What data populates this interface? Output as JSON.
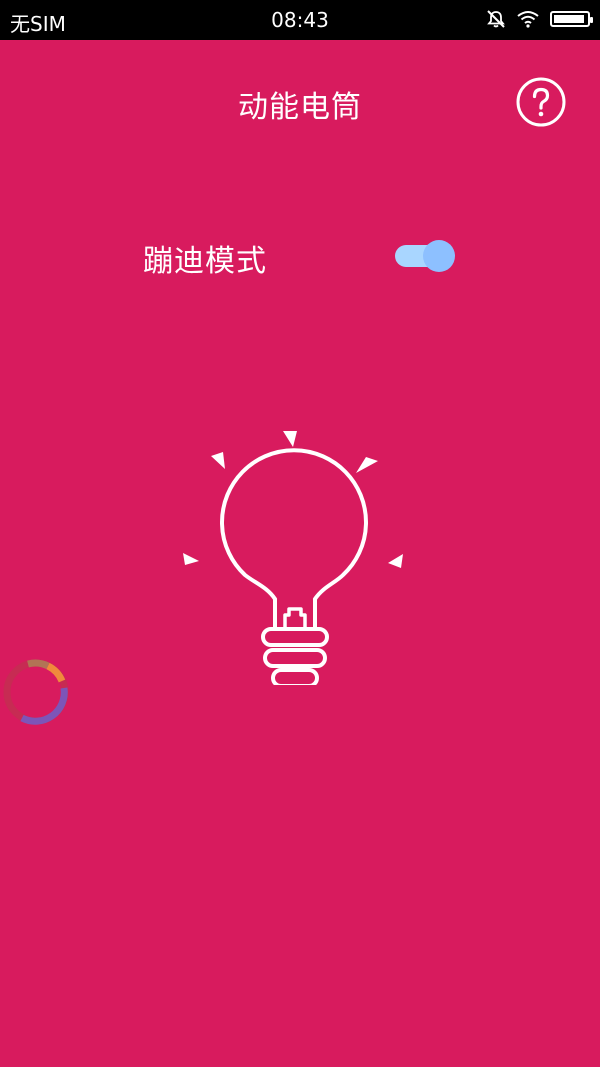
{
  "status_bar": {
    "carrier": "无SIM",
    "time": "08:43",
    "battery_level": 0.95,
    "icons": [
      "mute-icon",
      "wifi-icon",
      "battery-icon"
    ]
  },
  "header": {
    "title": "动能电筒",
    "help_icon": "question-circle-icon"
  },
  "mode": {
    "label": "蹦迪模式",
    "toggle_on": true
  },
  "bulb": {
    "icon": "light-bulb-icon"
  },
  "floating_widget": {
    "icon": "ring-progress-icon"
  },
  "colors": {
    "background": "#d81b5e",
    "toggle_track": "#a9d6ff",
    "toggle_thumb": "#8dc0ff",
    "foreground": "#ffffff"
  }
}
